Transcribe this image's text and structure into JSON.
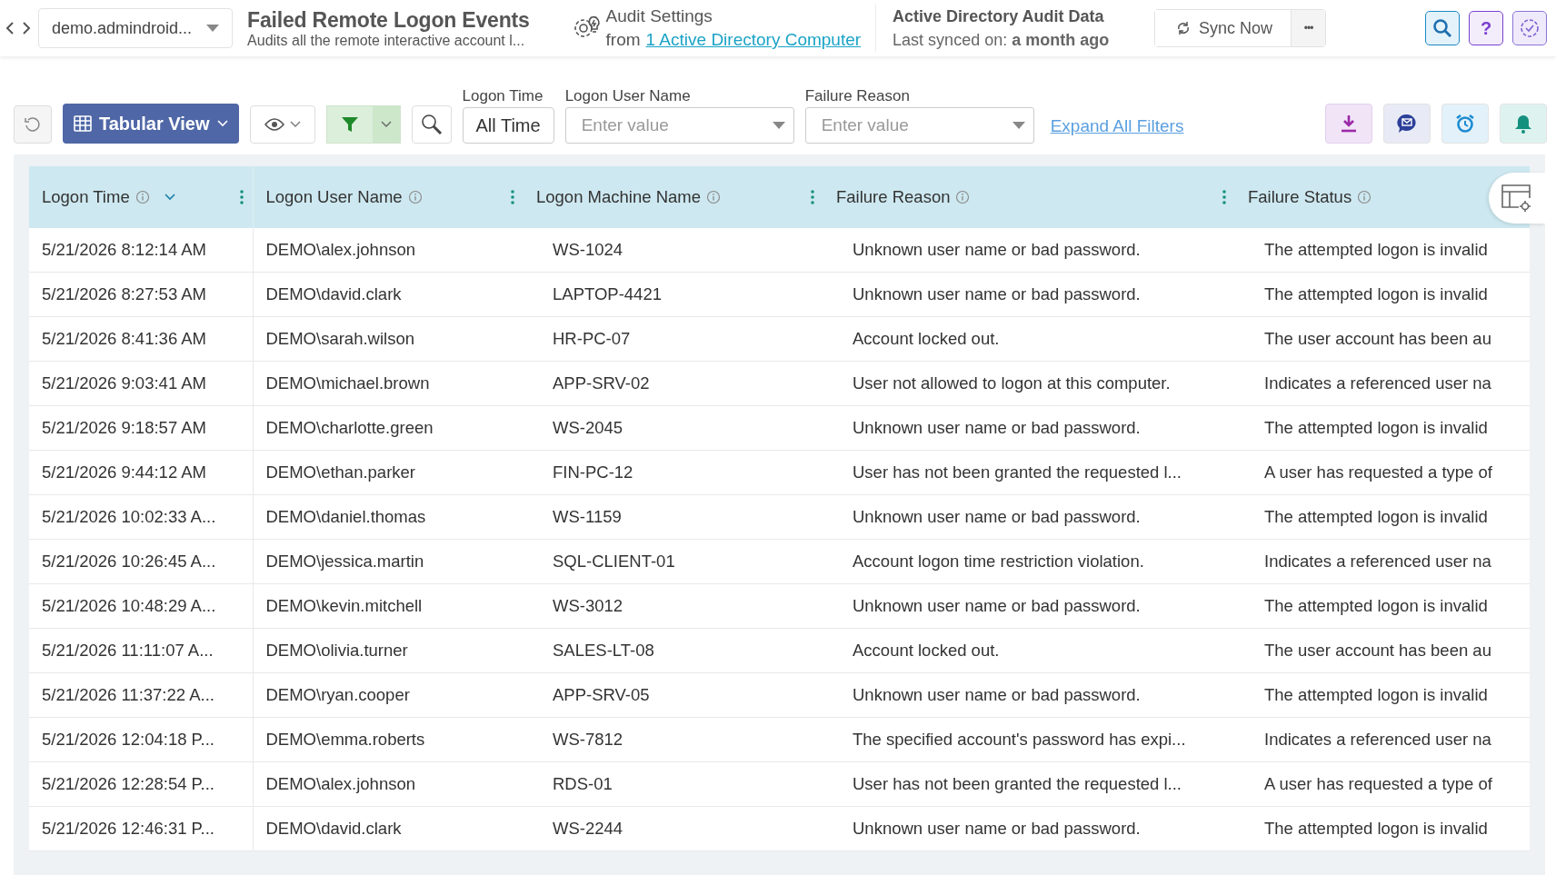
{
  "topbar": {
    "domain": "demo.admindroid...",
    "title": "Failed Remote Logon Events",
    "subtitle": "Audits all the remote interactive account l...",
    "audit_settings": {
      "label": "Audit Settings",
      "prefix": "from",
      "link": "1 Active Directory Computer"
    },
    "source": {
      "title": "Active Directory Audit Data",
      "synced": "Last synced on: **a month ago**"
    },
    "sync_button": "Sync Now",
    "more_button": "•••",
    "help_button": "?"
  },
  "toolbar": {
    "view_button": "Tabular View",
    "filter_active": true,
    "filters": [
      {
        "kind": "button",
        "label": "Logon Time",
        "value": "All Time"
      },
      {
        "kind": "select",
        "label": "Logon User Name",
        "placeholder": "Enter value"
      },
      {
        "kind": "select",
        "label": "Failure Reason",
        "placeholder": "Enter value"
      }
    ],
    "expand_link": "Expand All Filters"
  },
  "table": {
    "columns": [
      {
        "label": "Logon Time",
        "sorted": true
      },
      {
        "label": "Logon User Name",
        "sorted": false
      },
      {
        "label": "Logon Machine Name",
        "sorted": false
      },
      {
        "label": "Failure Reason",
        "sorted": false
      },
      {
        "label": "Failure Status",
        "sorted": false
      }
    ],
    "rows": [
      [
        "5/21/2026 8:12:14 AM",
        "DEMO\\alex.johnson",
        "WS-1024",
        "Unknown user name or bad password.",
        "The attempted logon is invalid"
      ],
      [
        "5/21/2026 8:27:53 AM",
        "DEMO\\david.clark",
        "LAPTOP-4421",
        "Unknown user name or bad password.",
        "The attempted logon is invalid"
      ],
      [
        "5/21/2026 8:41:36 AM",
        "DEMO\\sarah.wilson",
        "HR-PC-07",
        "Account locked out.",
        "The user account has been au"
      ],
      [
        "5/21/2026 9:03:41 AM",
        "DEMO\\michael.brown",
        "APP-SRV-02",
        "User not allowed to logon at this computer.",
        "Indicates a referenced user na"
      ],
      [
        "5/21/2026 9:18:57 AM",
        "DEMO\\charlotte.green",
        "WS-2045",
        "Unknown user name or bad password.",
        "The attempted logon is invalid"
      ],
      [
        "5/21/2026 9:44:12 AM",
        "DEMO\\ethan.parker",
        "FIN-PC-12",
        "User has not been granted the requested l...",
        "A user has requested a type of"
      ],
      [
        "5/21/2026 10:02:33 A...",
        "DEMO\\daniel.thomas",
        "WS-1159",
        "Unknown user name or bad password.",
        "The attempted logon is invalid"
      ],
      [
        "5/21/2026 10:26:45 A...",
        "DEMO\\jessica.martin",
        "SQL-CLIENT-01",
        "Account logon time restriction violation.",
        "Indicates a referenced user na"
      ],
      [
        "5/21/2026 10:48:29 A...",
        "DEMO\\kevin.mitchell",
        "WS-3012",
        "Unknown user name or bad password.",
        "The attempted logon is invalid"
      ],
      [
        "5/21/2026 11:11:07 A...",
        "DEMO\\olivia.turner",
        "SALES-LT-08",
        "Account locked out.",
        "The user account has been au"
      ],
      [
        "5/21/2026 11:37:22 A...",
        "DEMO\\ryan.cooper",
        "APP-SRV-05",
        "Unknown user name or bad password.",
        "The attempted logon is invalid"
      ],
      [
        "5/21/2026 12:04:18 P...",
        "DEMO\\emma.roberts",
        "WS-7812",
        "The specified account's password has expi...",
        "Indicates a referenced user na"
      ],
      [
        "5/21/2026 12:28:54 P...",
        "DEMO\\alex.johnson",
        "RDS-01",
        "User has not been granted the requested l...",
        "A user has requested a type of"
      ],
      [
        "5/21/2026 12:46:31 P...",
        "DEMO\\david.clark",
        "WS-2244",
        "Unknown user name or bad password.",
        "The attempted logon is invalid"
      ]
    ]
  }
}
